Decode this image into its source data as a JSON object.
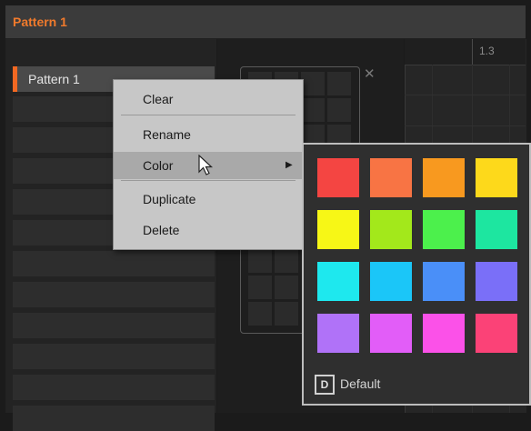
{
  "window": {
    "title": "Pattern 1"
  },
  "pattern_list": {
    "selected_pattern": "Pattern 1",
    "accent_color": "#f26822"
  },
  "timeline": {
    "position_label": "1.3"
  },
  "context_menu": {
    "items": [
      {
        "label": "Clear"
      },
      {
        "label": "Rename"
      },
      {
        "label": "Color"
      },
      {
        "label": "Duplicate"
      },
      {
        "label": "Delete"
      }
    ]
  },
  "color_palette": {
    "swatches": [
      "#f44542",
      "#f87444",
      "#f8991f",
      "#fdd91b",
      "#f7f716",
      "#a3e81b",
      "#4cf04c",
      "#1de6a0",
      "#1ee8ee",
      "#1bc6f8",
      "#4a8ff8",
      "#7a6ff8",
      "#b072f8",
      "#e25df8",
      "#fb51e8",
      "#fb4277"
    ],
    "default_icon": "D",
    "default_label": "Default"
  },
  "icons": {
    "close": "close-icon",
    "submenu": "chevron-right-icon",
    "cursor": "mouse-pointer-icon"
  }
}
